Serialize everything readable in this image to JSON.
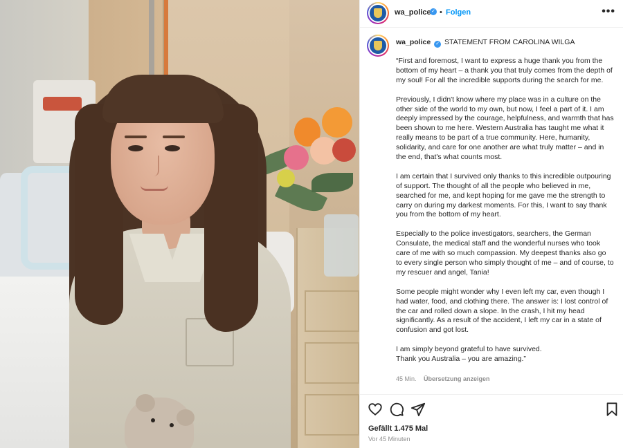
{
  "post_header": {
    "username": "wa_police",
    "separator": "•",
    "follow_label": "Folgen",
    "more_icon": "more-horizontal-icon",
    "verified_icon": "verified-badge-icon"
  },
  "caption": {
    "username": "wa_police",
    "title": "STATEMENT FROM CAROLINA WILGA",
    "paragraphs": [
      "“First and foremost, I want to express a huge thank you from the bottom of my heart – a thank you that truly comes from the depth of my soul! For all the incredible supports during the search for me.",
      "Previously, I didn't know where my place was in a culture on the other side of the world to my own, but now, I feel a part of it. I am deeply impressed by the courage, helpfulness, and warmth that has been shown to me here. Western Australia has taught me what it really means to be part of a true community. Here, humanity, solidarity, and care for one another are what truly matter – and in the end, that's what counts most.",
      "I am certain that I survived only thanks to this incredible outpouring of support. The thought of all the people who believed in me, searched for me, and kept hoping for me gave me the strength to carry on during my darkest moments. For this, I want to say thank you from the bottom of my heart.",
      "Especially to the police investigators, searchers, the German Consulate, the medical staff and the wonderful nurses who took care of me with so much compassion. My deepest thanks also go to every single person who simply thought of me – and of course, to my rescuer and angel, Tania!",
      "Some people might wonder why I even left my car, even though I had water, food, and clothing there. The answer is: I lost control of the car and rolled down a slope. In the crash, I hit my head significantly. As a result of the accident, I left my car in a state of confusion and got lost.",
      "I am simply beyond grateful to have survived.",
      "Thank you Australia – you are amazing.”"
    ],
    "time": "45 Min.",
    "translate_label": "Übersetzung anzeigen"
  },
  "actions": {
    "icons": [
      "heart-icon",
      "comment-icon",
      "share-icon",
      "bookmark-icon"
    ],
    "likes": "Gefällt 1.475 Mal",
    "posted_ago": "Vor 45 Minuten"
  },
  "colors": {
    "link_blue": "#0095f6",
    "verified_blue": "#3897f0",
    "muted_text": "#8e8e8e",
    "text": "#262626"
  }
}
